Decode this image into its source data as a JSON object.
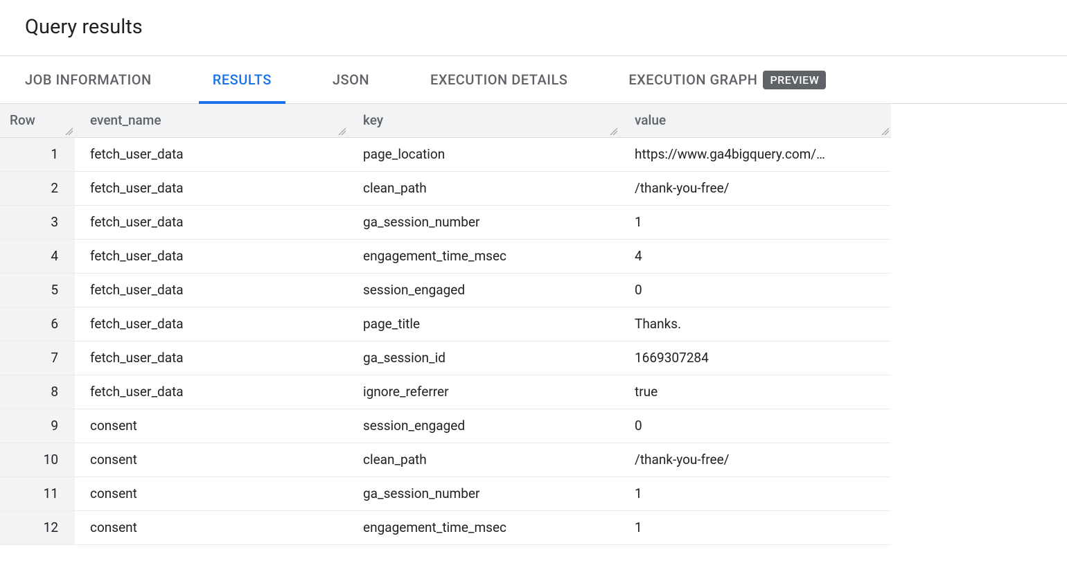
{
  "title": "Query results",
  "tabs": [
    {
      "label": "JOB INFORMATION",
      "active": false,
      "badge": null
    },
    {
      "label": "RESULTS",
      "active": true,
      "badge": null
    },
    {
      "label": "JSON",
      "active": false,
      "badge": null
    },
    {
      "label": "EXECUTION DETAILS",
      "active": false,
      "badge": null
    },
    {
      "label": "EXECUTION GRAPH",
      "active": false,
      "badge": "PREVIEW"
    }
  ],
  "columns": {
    "row": "Row",
    "event": "event_name",
    "key": "key",
    "value": "value"
  },
  "rows": [
    {
      "n": "1",
      "event_name": "fetch_user_data",
      "key": "page_location",
      "value": "https://www.ga4bigquery.com/…"
    },
    {
      "n": "2",
      "event_name": "fetch_user_data",
      "key": "clean_path",
      "value": "/thank-you-free/"
    },
    {
      "n": "3",
      "event_name": "fetch_user_data",
      "key": "ga_session_number",
      "value": "1"
    },
    {
      "n": "4",
      "event_name": "fetch_user_data",
      "key": "engagement_time_msec",
      "value": "4"
    },
    {
      "n": "5",
      "event_name": "fetch_user_data",
      "key": "session_engaged",
      "value": "0"
    },
    {
      "n": "6",
      "event_name": "fetch_user_data",
      "key": "page_title",
      "value": "Thanks."
    },
    {
      "n": "7",
      "event_name": "fetch_user_data",
      "key": "ga_session_id",
      "value": "1669307284"
    },
    {
      "n": "8",
      "event_name": "fetch_user_data",
      "key": "ignore_referrer",
      "value": "true"
    },
    {
      "n": "9",
      "event_name": "consent",
      "key": "session_engaged",
      "value": "0"
    },
    {
      "n": "10",
      "event_name": "consent",
      "key": "clean_path",
      "value": "/thank-you-free/"
    },
    {
      "n": "11",
      "event_name": "consent",
      "key": "ga_session_number",
      "value": "1"
    },
    {
      "n": "12",
      "event_name": "consent",
      "key": "engagement_time_msec",
      "value": "1"
    }
  ]
}
